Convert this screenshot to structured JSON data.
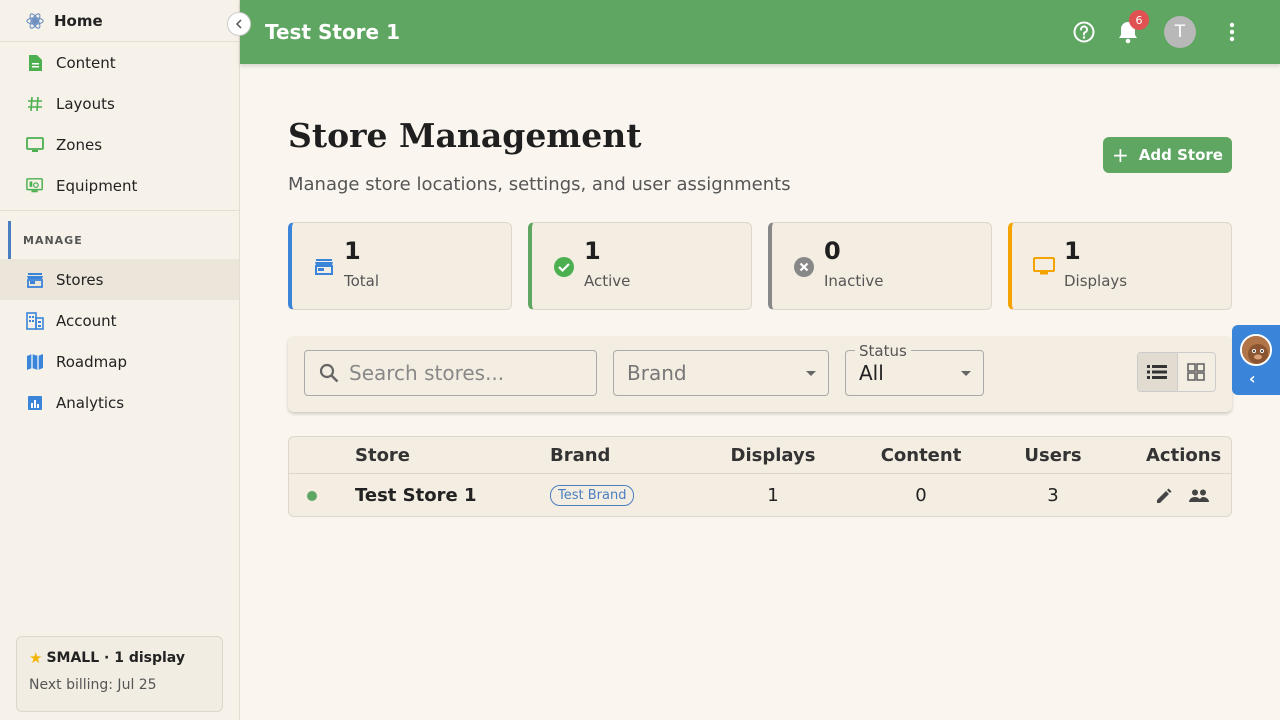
{
  "sidebar": {
    "home_label": "Home",
    "top_items": [
      {
        "label": "Content",
        "icon": "document-icon"
      },
      {
        "label": "Layouts",
        "icon": "hash-icon"
      },
      {
        "label": "Zones",
        "icon": "monitor-icon"
      },
      {
        "label": "Equipment",
        "icon": "equipment-icon"
      }
    ],
    "section_label": "MANAGE",
    "manage_items": [
      {
        "label": "Stores",
        "icon": "store-icon",
        "active": true
      },
      {
        "label": "Account",
        "icon": "building-icon"
      },
      {
        "label": "Roadmap",
        "icon": "map-icon"
      },
      {
        "label": "Analytics",
        "icon": "analytics-icon"
      }
    ],
    "plan": {
      "title": "SMALL · 1 display",
      "billing": "Next billing: Jul 25"
    }
  },
  "topbar": {
    "title": "Test Store 1",
    "notification_count": "6",
    "avatar_initial": "T"
  },
  "page": {
    "title": "Store Management",
    "subtitle": "Manage store locations, settings, and user assignments",
    "add_button": "Add Store"
  },
  "stats": [
    {
      "value": "1",
      "label": "Total",
      "color": "#3a85d9"
    },
    {
      "value": "1",
      "label": "Active",
      "color": "#5fa663"
    },
    {
      "value": "0",
      "label": "Inactive",
      "color": "#888888"
    },
    {
      "value": "1",
      "label": "Displays",
      "color": "#f4a300"
    }
  ],
  "filters": {
    "search_placeholder": "Search stores...",
    "brand_placeholder": "Brand",
    "status_label": "Status",
    "status_value": "All"
  },
  "table": {
    "columns": [
      "Store",
      "Brand",
      "Displays",
      "Content",
      "Users",
      "Actions"
    ],
    "rows": [
      {
        "store": "Test Store 1",
        "brand": "Test Brand",
        "displays": "1",
        "content": "0",
        "users": "3",
        "status": "active"
      }
    ]
  }
}
